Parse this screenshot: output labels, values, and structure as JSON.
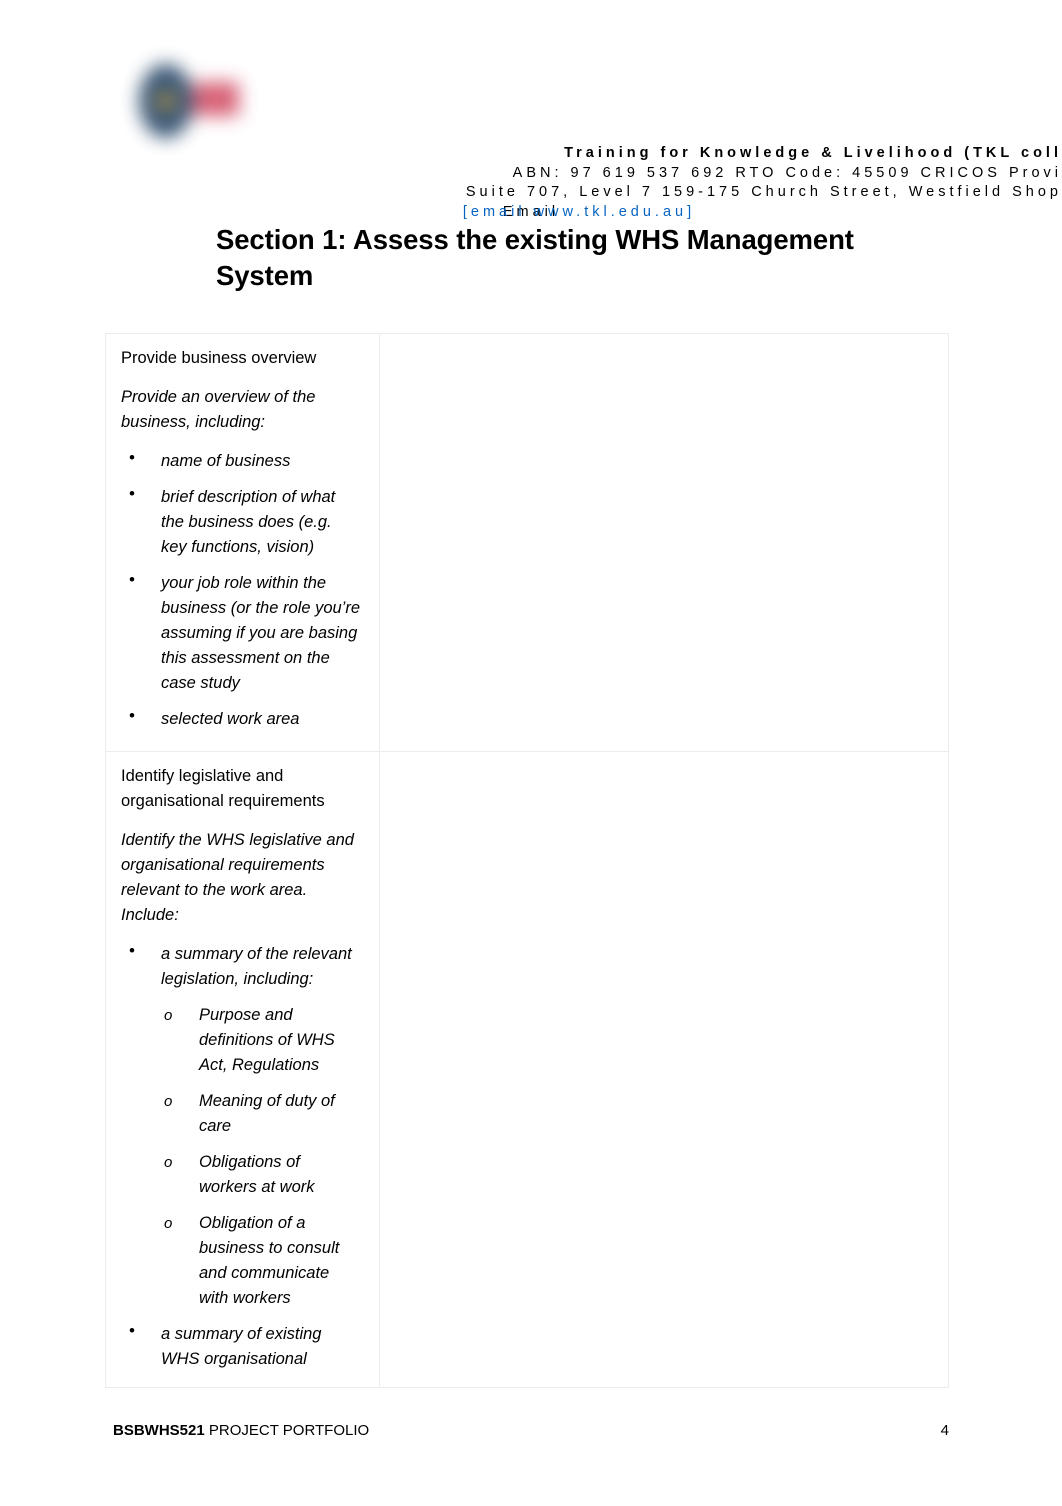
{
  "header": {
    "logo_alt": "TKL College logo",
    "line1": "Training for Knowledge & Livelihood (TKL coll",
    "line2": "ABN: 97 619 537 692 RTO Code: 45509 CRICOS Provi",
    "line3": "Suite 707, Level 7 159-175 Church Street, Westfield Shop",
    "email_label": "Email",
    "email_link": "[email www.tkl.edu.au]",
    "link_color": "#0563C1"
  },
  "title": "Section 1: Assess the existing WHS Management System",
  "table": {
    "rows": [
      {
        "heading": "Provide business overview",
        "intro": "Provide an overview of the business, including:",
        "bullets": [
          "name of business",
          "brief description of what the business does (e.g. key functions, vision)",
          "your job role within the business (or the role you’re assuming if you are basing this assessment on the case study",
          "selected work area"
        ],
        "answer": ""
      },
      {
        "heading": "Identify legislative and organisational requirements",
        "intro": "Identify the WHS legislative and organisational requirements relevant to the work area. Include:",
        "bullets": [
          "a summary of the relevant legislation, including:",
          "a summary of existing WHS organisational"
        ],
        "sub_bullets": [
          "Purpose and definitions of WHS Act, Regulations",
          "Meaning of duty of care",
          "Obligations of workers at work",
          "Obligation of a business to consult and communicate with workers"
        ],
        "answer": ""
      }
    ]
  },
  "footer": {
    "code": "BSBWHS521",
    "doc_name": " PROJECT PORTFOLIO",
    "page_number": "4"
  }
}
